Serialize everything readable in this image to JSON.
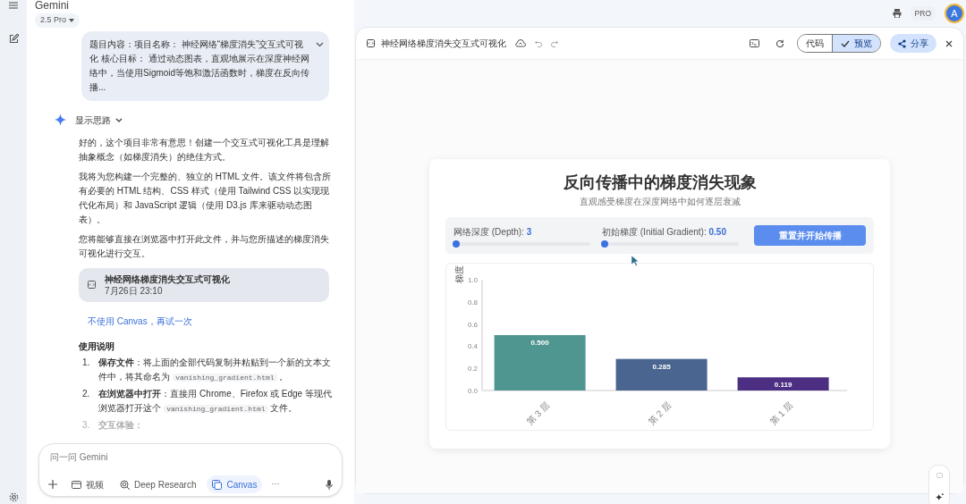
{
  "app": {
    "title": "Gemini",
    "model": "2.5 Pro",
    "plan": "PRO",
    "avatar": "A"
  },
  "chat": {
    "user_prompt": "题目内容：项目名称： 神经网络“梯度消失”交互式可视化 核心目标： 通过动态图表，直观地展示在深度神经网络中，当使用Sigmoid等饱和激活函数时，梯度在反向传播...",
    "thoughts_toggle": "显示思路",
    "paragraphs": [
      "好的，这个项目非常有意思！创建一个交互式可视化工具是理解抽象概念（如梯度消失）的绝佳方式。",
      "我将为您构建一个完整的、独立的 HTML 文件。该文件将包含所有必要的 HTML 结构、CSS 样式（使用 Tailwind CSS 以实现现代化布局）和 JavaScript 逻辑（使用 D3.js 库来驱动动态图表）。",
      "您将能够直接在浏览器中打开此文件，并与您所描述的梯度消失可视化进行交互。"
    ],
    "artifact": {
      "title": "神经网络梯度消失交互式可视化",
      "date": "7月26日 23:10"
    },
    "retry_link": "不使用 Canvas，再试一次",
    "instructions_heading": "使用说明",
    "steps": [
      {
        "number": "1.",
        "label": "保存文件",
        "text": "：将上面的全部代码复制并粘贴到一个新的文本文件中，将其命名为 ",
        "code": "vanishing_gradient.html",
        "after": " 。"
      },
      {
        "number": "2.",
        "label": "在浏览器中打开",
        "text": "：直接用 Chrome、Firefox 或 Edge 等现代浏览器打开这个 ",
        "code": "vanishing_gradient.html",
        "after": " 文件。"
      },
      {
        "number": "3.",
        "label": "交互体验："
      }
    ],
    "input": {
      "placeholder": "问一问 Gemini",
      "tools": [
        {
          "kind": "video",
          "label": "视频",
          "selected": false
        },
        {
          "kind": "research",
          "label": "Deep Research",
          "selected": false
        },
        {
          "kind": "canvas",
          "label": "Canvas",
          "selected": true
        }
      ],
      "more": "···"
    }
  },
  "canvas": {
    "title": "神经网络梯度消失交互式可视化",
    "view_tabs": [
      {
        "label": "代码",
        "selected": false
      },
      {
        "label": "预览",
        "selected": true
      }
    ],
    "share": "分享",
    "preview": {
      "heading": "反向传播中的梯度消失现象",
      "subheading": "直观感受梯度在深度网络中如何逐层衰减",
      "sliders": [
        {
          "label": "网络深度 (Depth): ",
          "value": "3",
          "level": 0
        },
        {
          "label": "初始梯度 (Initial Gradient): ",
          "value": "0.50",
          "level": 0
        }
      ],
      "reset_button": "重置并开始传播",
      "chart_data": {
        "type": "bar",
        "ylabel": "梯度",
        "categories": [
          "第 3 层",
          "第 2 层",
          "第 1 层"
        ],
        "series": [
          {
            "values": [
              0.5,
              0.285,
              0.119
            ]
          }
        ],
        "ylim": [
          0,
          1
        ],
        "yticks": [
          {
            "value": 0,
            "label": "0.0"
          },
          {
            "value": 0.2,
            "label": "0.2"
          },
          {
            "value": 0.4,
            "label": "0.4"
          },
          {
            "value": 0.6,
            "label": "0.6"
          },
          {
            "value": 0.8,
            "label": "0.8"
          },
          {
            "value": 1,
            "label": "1.0"
          }
        ],
        "value_labels": [
          "0.500",
          "0.285",
          "0.119"
        ]
      }
    }
  }
}
